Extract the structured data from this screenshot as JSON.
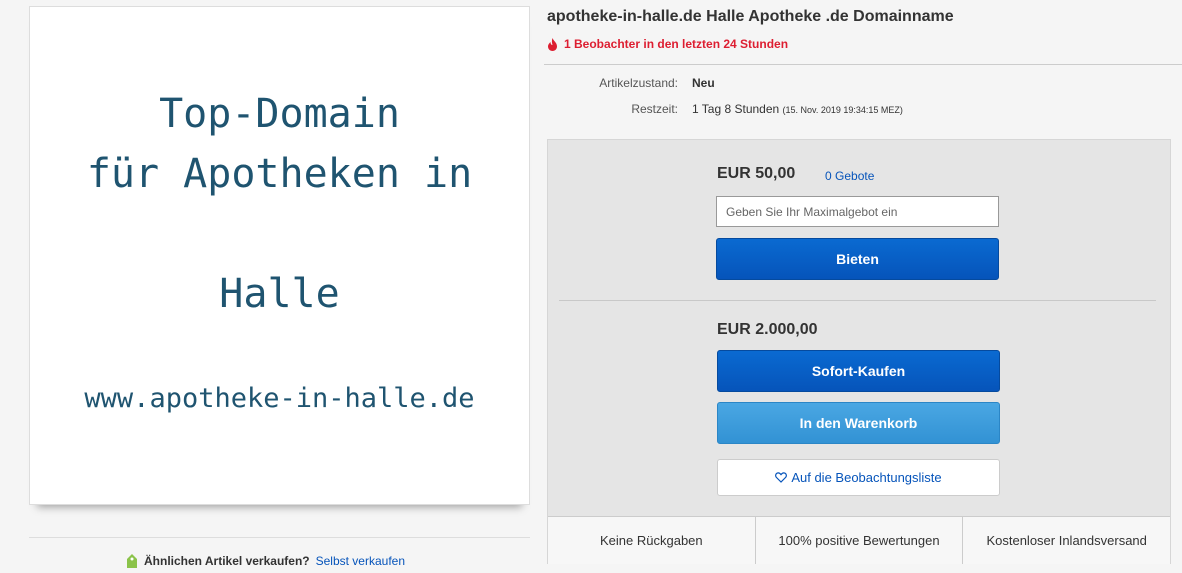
{
  "gallery": {
    "line1": "Top-Domain",
    "line2": "für Apotheken in",
    "line3": "Halle",
    "url": "www.apotheke-in-halle.de"
  },
  "sell": {
    "question": "Ähnlichen Artikel verkaufen?",
    "link": "Selbst verkaufen"
  },
  "listing": {
    "title": "apotheke-in-halle.de Halle Apotheke .de Domainname",
    "watchers": "1 Beobachter in den letzten 24 Stunden",
    "condition_label": "Artikelzustand:",
    "condition_value": "Neu",
    "time_label": "Restzeit:",
    "time_value": "1 Tag 8 Stunden",
    "time_detail": "(15. Nov. 2019   19:34:15 MEZ)"
  },
  "bid": {
    "price": "EUR 50,00",
    "bids": "0 Gebote",
    "placeholder": "Geben Sie Ihr Maximalgebot ein",
    "button": "Bieten"
  },
  "buy": {
    "price": "EUR 2.000,00",
    "buy_now": "Sofort-Kaufen",
    "cart": "In den Warenkorb",
    "watchlist": "Auf die Beobachtungsliste"
  },
  "features": [
    "Keine Rückgaben",
    "100% positive Bewertungen",
    "Kostenloser Inlandsversand"
  ],
  "colors": {
    "accent": "#0654ba",
    "alert": "#dd1e31",
    "promo_text": "#1f5470"
  },
  "icons": {
    "watch": "flame-icon",
    "sell": "tag-icon",
    "watchlist": "heart-icon"
  }
}
